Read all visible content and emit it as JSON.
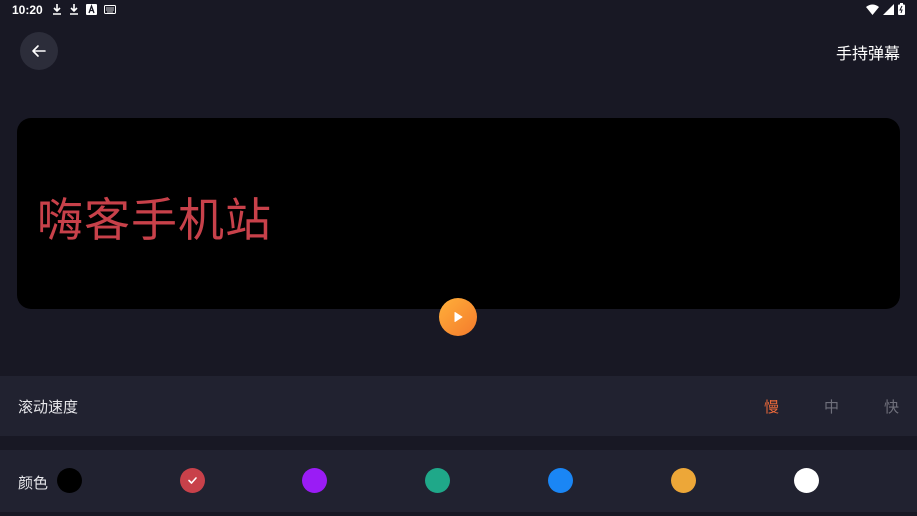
{
  "status_bar": {
    "time": "10:20",
    "left_icons": [
      "download-icon",
      "download-icon",
      "a-icon",
      "keyboard-icon"
    ],
    "right_icons": [
      "wifi-icon",
      "signal-icon",
      "battery-icon"
    ]
  },
  "header": {
    "back_icon": "arrow-left-icon",
    "title": "手持弹幕"
  },
  "preview": {
    "text": "嗨客手机站",
    "text_color": "#c8414a",
    "play_icon": "play-icon"
  },
  "speed": {
    "label": "滚动速度",
    "options": [
      "慢",
      "中",
      "快"
    ],
    "selected": "慢"
  },
  "color": {
    "label": "颜色",
    "swatches": [
      "#000000",
      "#c8414a",
      "#9a1cf5",
      "#1fa889",
      "#1a86f5",
      "#eda738",
      "#ffffff"
    ],
    "selected": "#c8414a"
  }
}
